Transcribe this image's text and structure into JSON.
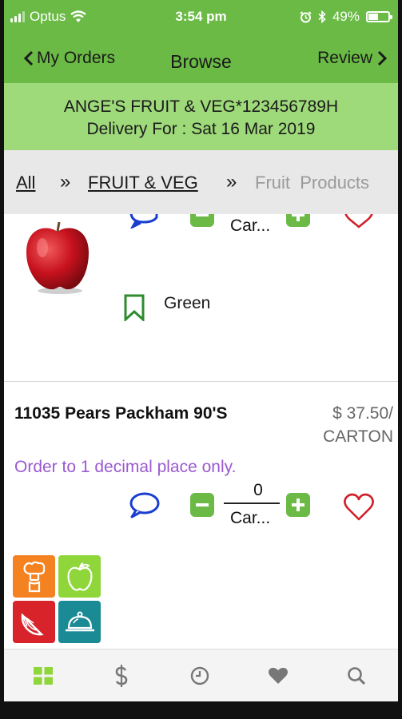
{
  "status_bar": {
    "carrier": "Optus",
    "time": "3:54 pm",
    "battery": "49%",
    "battery_level": 0.49
  },
  "nav": {
    "back_label": "My Orders",
    "title": "Browse",
    "review_label": "Review"
  },
  "banner": {
    "customer": "ANGE'S FRUIT & VEG*123456789H",
    "delivery": "Delivery For : Sat 16 Mar 2019"
  },
  "breadcrumb": {
    "all": "All",
    "sep1": "»",
    "category": "FRUIT & VEG",
    "sep2": "»",
    "current": "Fruit  Products"
  },
  "products": [
    {
      "unit_label": "Car...",
      "list_label": "Green"
    },
    {
      "name": "11035 Pears Packham 90'S",
      "price": "$ 37.50/ CARTON",
      "note": "Order to 1 decimal place only.",
      "quantity": "0",
      "unit_label": "Car..."
    }
  ],
  "category_tiles": [
    "chef-tile",
    "apple-tile",
    "orange-slice-tile",
    "cloche-tile"
  ],
  "tabs": [
    "grid-icon",
    "dollar-icon",
    "clock-icon",
    "heart-icon",
    "search-icon"
  ],
  "colors": {
    "accent_green": "#6aba45",
    "banner_green": "#9ed97a",
    "note_purple": "#9b59d0",
    "heart_red": "#d0202a",
    "comment_blue": "#1a3fd0"
  }
}
